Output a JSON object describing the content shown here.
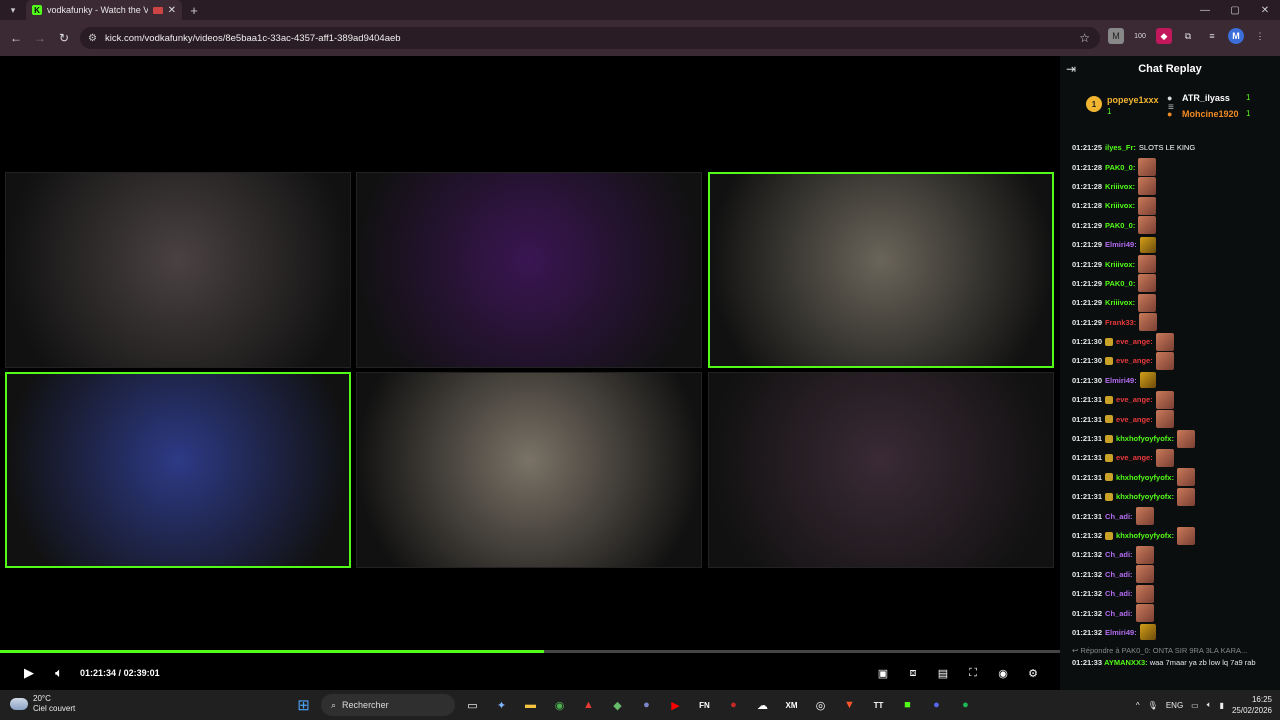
{
  "browser": {
    "tab_title": "vodkafunky - Watch the VO",
    "tab_favicon": "K",
    "url": "kick.com/vodkafunky/videos/8e5baa1c-33ac-4357-aff1-389ad9404aeb",
    "extension_badge": "100",
    "profile_initial": "M"
  },
  "player": {
    "time_current": "01:21:34",
    "time_total": "02:39:01",
    "time_separator": "/",
    "progress_fraction": 0.513,
    "accent": "#53fc18",
    "tiles": [
      {
        "tone": "#4a4242",
        "active": false
      },
      {
        "tone": "#3a1552",
        "active": false
      },
      {
        "tone": "#6a655a",
        "active": true
      },
      {
        "tone": "#2d3a86",
        "active": true
      },
      {
        "tone": "#7a7266",
        "active": false
      },
      {
        "tone": "#3a2a35",
        "active": false
      }
    ]
  },
  "chat": {
    "title": "Chat Replay",
    "top_gifters": [
      {
        "rank": "1",
        "name": "popeye1xxx",
        "count": "1",
        "color": "#f2b530"
      },
      {
        "name": "ATR_ilyass",
        "count": "1",
        "color": "#ffffff"
      },
      {
        "name": "Mohcine1920",
        "count": "1",
        "color": "#f08a24"
      }
    ],
    "messages": [
      {
        "ts": "01:21:25",
        "user": "ilyes_Fr:",
        "color": "#53fc18",
        "text": "SLOTS LE KING",
        "emote": ""
      },
      {
        "ts": "01:21:28",
        "user": "PAK0_0:",
        "color": "#53fc18",
        "text": "",
        "emote": "face"
      },
      {
        "ts": "01:21:28",
        "user": "Kriiivox:",
        "color": "#53fc18",
        "text": "",
        "emote": "face"
      },
      {
        "ts": "01:21:28",
        "user": "Kriiivox:",
        "color": "#53fc18",
        "text": "",
        "emote": "face"
      },
      {
        "ts": "01:21:29",
        "user": "PAK0_0:",
        "color": "#53fc18",
        "text": "",
        "emote": "face"
      },
      {
        "ts": "01:21:29",
        "user": "Elmiri49:",
        "color": "#b36cf0",
        "text": "",
        "emote": "gold"
      },
      {
        "ts": "01:21:29",
        "user": "Kriiivox:",
        "color": "#53fc18",
        "text": "",
        "emote": "face"
      },
      {
        "ts": "01:21:29",
        "user": "PAK0_0:",
        "color": "#53fc18",
        "text": "",
        "emote": "face"
      },
      {
        "ts": "01:21:29",
        "user": "Kriiivox:",
        "color": "#53fc18",
        "text": "",
        "emote": "face"
      },
      {
        "ts": "01:21:29",
        "user": "Frank33:",
        "color": "#e8393c",
        "text": "",
        "emote": "face"
      },
      {
        "ts": "01:21:30",
        "user": "eve_ange:",
        "color": "#e8393c",
        "text": "",
        "emote": "face",
        "badge": true
      },
      {
        "ts": "01:21:30",
        "user": "eve_ange:",
        "color": "#e8393c",
        "text": "",
        "emote": "face",
        "badge": true
      },
      {
        "ts": "01:21:30",
        "user": "Elmiri49:",
        "color": "#b36cf0",
        "text": "",
        "emote": "gold"
      },
      {
        "ts": "01:21:31",
        "user": "eve_ange:",
        "color": "#e8393c",
        "text": "",
        "emote": "face",
        "badge": true
      },
      {
        "ts": "01:21:31",
        "user": "eve_ange:",
        "color": "#e8393c",
        "text": "",
        "emote": "face",
        "badge": true
      },
      {
        "ts": "01:21:31",
        "user": "khxhofyoyfyofx:",
        "color": "#53fc18",
        "text": "",
        "emote": "face",
        "badge": true
      },
      {
        "ts": "01:21:31",
        "user": "eve_ange:",
        "color": "#e8393c",
        "text": "",
        "emote": "face",
        "badge": true
      },
      {
        "ts": "01:21:31",
        "user": "khxhofyoyfyofx:",
        "color": "#53fc18",
        "text": "",
        "emote": "face",
        "badge": true
      },
      {
        "ts": "01:21:31",
        "user": "khxhofyoyfyofx:",
        "color": "#53fc18",
        "text": "",
        "emote": "face",
        "badge": true
      },
      {
        "ts": "01:21:31",
        "user": "Ch_adi:",
        "color": "#b36cf0",
        "text": "",
        "emote": "face"
      },
      {
        "ts": "01:21:32",
        "user": "khxhofyoyfyofx:",
        "color": "#53fc18",
        "text": "",
        "emote": "face",
        "badge": true
      },
      {
        "ts": "01:21:32",
        "user": "Ch_adi:",
        "color": "#b36cf0",
        "text": "",
        "emote": "face"
      },
      {
        "ts": "01:21:32",
        "user": "Ch_adi:",
        "color": "#b36cf0",
        "text": "",
        "emote": "face"
      },
      {
        "ts": "01:21:32",
        "user": "Ch_adi:",
        "color": "#b36cf0",
        "text": "",
        "emote": "face"
      },
      {
        "ts": "01:21:32",
        "user": "Ch_adi:",
        "color": "#b36cf0",
        "text": "",
        "emote": "face"
      },
      {
        "ts": "01:21:32",
        "user": "Elmiri49:",
        "color": "#b36cf0",
        "text": "",
        "emote": "gold"
      }
    ],
    "reply_to": "Répondre à PAK0_0: ONTA SIR 9RA 3LA KARA...",
    "last_message": {
      "ts": "01:21:33",
      "user": "AYMANXX3:",
      "color": "#53fc18",
      "text": "waa 7maar ya zb low lq 7a9 rab"
    }
  },
  "taskbar": {
    "temperature": "20°C",
    "weather": "Ciel couvert",
    "search_placeholder": "Rechercher",
    "language": "ENG",
    "time": "16:25",
    "date": "25/02/2026"
  }
}
